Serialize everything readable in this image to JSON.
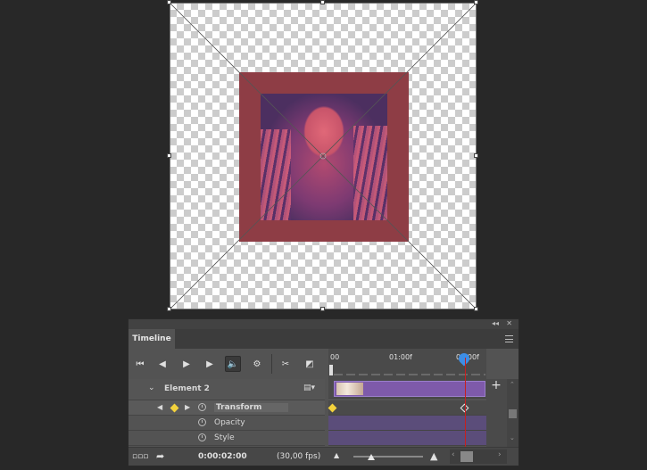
{
  "canvas": {
    "colors": {
      "frame": "#8e3d45",
      "photo_tint": "#c8546a",
      "checker": "#cccccc"
    }
  },
  "panel": {
    "collapse_label": "◂◂",
    "close_label": "✕",
    "tab_label": "Timeline",
    "menu_icon": "panel-menu-icon"
  },
  "controls": {
    "go_to_first": "⏮",
    "prev_frame": "◀",
    "play": "▶",
    "next_frame": "▶",
    "audio": "🔈",
    "settings": "⚙",
    "split": "✂",
    "transition": "◩"
  },
  "ruler": {
    "labels": [
      "00",
      "01:00f",
      "02:00f"
    ],
    "playhead_color": "#c81e1e",
    "accent": "#3d8ee6"
  },
  "layers": {
    "element": {
      "label": "Element 2",
      "toggle": "⌄",
      "film_icon": "▤▾"
    },
    "transform": {
      "label": "Transform"
    },
    "opacity": {
      "label": "Opacity"
    },
    "style": {
      "label": "Style"
    }
  },
  "tracks": {
    "clip_color": "#7e5aaa",
    "keyframe_color": "#f3d23c"
  },
  "add_label": "+",
  "status": {
    "frames_icon": "▫▫▫",
    "convert_icon": "➦",
    "time": "0:00:02:00",
    "fps": "(30,00 fps)"
  }
}
